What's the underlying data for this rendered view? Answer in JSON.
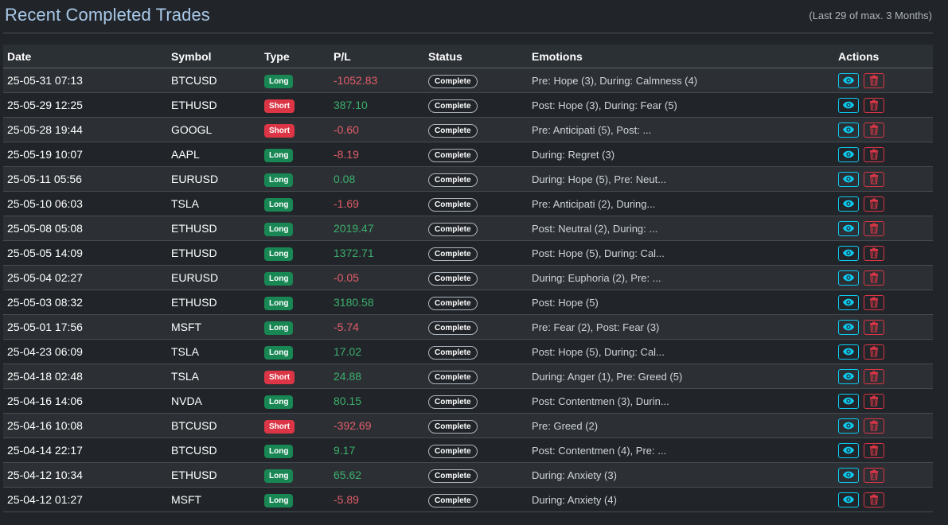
{
  "header": {
    "title": "Recent Completed Trades",
    "subtitle": "(Last 29 of max. 3 Months)"
  },
  "table": {
    "columns": [
      "Date",
      "Symbol",
      "Type",
      "P/L",
      "Status",
      "Emotions",
      "Actions"
    ],
    "rows": [
      {
        "date": "25-05-31 07:13",
        "symbol": "BTCUSD",
        "type": "Long",
        "pl": "-1052.83",
        "status": "Complete",
        "emotions": "Pre: Hope (3), During: Calmness (4)"
      },
      {
        "date": "25-05-29 12:25",
        "symbol": "ETHUSD",
        "type": "Short",
        "pl": "387.10",
        "status": "Complete",
        "emotions": "Post: Hope (3), During: Fear (5)"
      },
      {
        "date": "25-05-28 19:44",
        "symbol": "GOOGL",
        "type": "Short",
        "pl": "-0.60",
        "status": "Complete",
        "emotions": "Pre: Anticipati (5), Post: ..."
      },
      {
        "date": "25-05-19 10:07",
        "symbol": "AAPL",
        "type": "Long",
        "pl": "-8.19",
        "status": "Complete",
        "emotions": "During: Regret (3)"
      },
      {
        "date": "25-05-11 05:56",
        "symbol": "EURUSD",
        "type": "Long",
        "pl": "0.08",
        "status": "Complete",
        "emotions": "During: Hope (5), Pre: Neut..."
      },
      {
        "date": "25-05-10 06:03",
        "symbol": "TSLA",
        "type": "Long",
        "pl": "-1.69",
        "status": "Complete",
        "emotions": "Pre: Anticipati (2), During..."
      },
      {
        "date": "25-05-08 05:08",
        "symbol": "ETHUSD",
        "type": "Long",
        "pl": "2019.47",
        "status": "Complete",
        "emotions": "Post: Neutral (2), During: ..."
      },
      {
        "date": "25-05-05 14:09",
        "symbol": "ETHUSD",
        "type": "Long",
        "pl": "1372.71",
        "status": "Complete",
        "emotions": "Post: Hope (5), During: Cal..."
      },
      {
        "date": "25-05-04 02:27",
        "symbol": "EURUSD",
        "type": "Long",
        "pl": "-0.05",
        "status": "Complete",
        "emotions": "During: Euphoria (2), Pre: ..."
      },
      {
        "date": "25-05-03 08:32",
        "symbol": "ETHUSD",
        "type": "Long",
        "pl": "3180.58",
        "status": "Complete",
        "emotions": "Post: Hope (5)"
      },
      {
        "date": "25-05-01 17:56",
        "symbol": "MSFT",
        "type": "Long",
        "pl": "-5.74",
        "status": "Complete",
        "emotions": "Pre: Fear (2), Post: Fear (3)"
      },
      {
        "date": "25-04-23 06:09",
        "symbol": "TSLA",
        "type": "Long",
        "pl": "17.02",
        "status": "Complete",
        "emotions": "Post: Hope (5), During: Cal..."
      },
      {
        "date": "25-04-18 02:48",
        "symbol": "TSLA",
        "type": "Short",
        "pl": "24.88",
        "status": "Complete",
        "emotions": "During: Anger (1), Pre: Greed (5)"
      },
      {
        "date": "25-04-16 14:06",
        "symbol": "NVDA",
        "type": "Long",
        "pl": "80.15",
        "status": "Complete",
        "emotions": "Post: Contentmen (3), Durin..."
      },
      {
        "date": "25-04-16 10:08",
        "symbol": "BTCUSD",
        "type": "Short",
        "pl": "-392.69",
        "status": "Complete",
        "emotions": "Pre: Greed (2)"
      },
      {
        "date": "25-04-14 22:17",
        "symbol": "BTCUSD",
        "type": "Long",
        "pl": "9.17",
        "status": "Complete",
        "emotions": "Post: Contentmen (4), Pre: ..."
      },
      {
        "date": "25-04-12 10:34",
        "symbol": "ETHUSD",
        "type": "Long",
        "pl": "65.62",
        "status": "Complete",
        "emotions": "During: Anxiety (3)"
      },
      {
        "date": "25-04-12 01:27",
        "symbol": "MSFT",
        "type": "Long",
        "pl": "-5.89",
        "status": "Complete",
        "emotions": "During: Anxiety (4)"
      }
    ]
  },
  "icons": {
    "view": "eye-icon",
    "delete": "trash-icon"
  },
  "colors": {
    "long": "#198754",
    "short": "#dc3545",
    "profit": "#3cae6d",
    "loss": "#e35d6a",
    "view_button": "#0dcaf0",
    "delete_button": "#dc3545"
  }
}
